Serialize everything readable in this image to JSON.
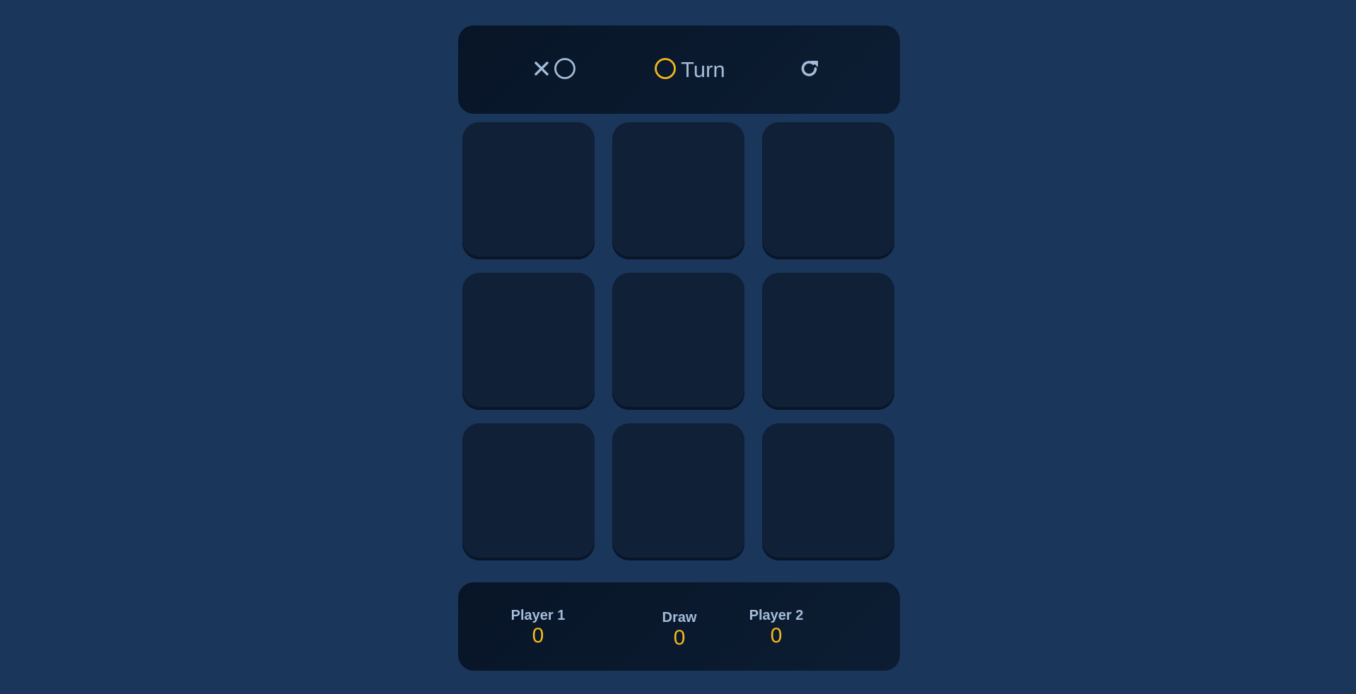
{
  "header": {
    "logo_icons": [
      "x-mark-icon",
      "o-mark-icon"
    ],
    "turn": {
      "current_mark_icon": "o-mark-icon",
      "label": "Turn"
    },
    "restart_icon": "restart-icon"
  },
  "board": {
    "cells": [
      "",
      "",
      "",
      "",
      "",
      "",
      "",
      "",
      ""
    ]
  },
  "scoreboard": {
    "player1": {
      "label": "Player 1",
      "value": "0"
    },
    "draw": {
      "label": "Draw",
      "value": "0"
    },
    "player2": {
      "label": "Player 2",
      "value": "0"
    }
  },
  "colors": {
    "background": "#1a365a",
    "panel": "#0a182b",
    "cell": "#0f2037",
    "text_light": "#a3bcd8",
    "accent_yellow": "#f5b81c"
  }
}
